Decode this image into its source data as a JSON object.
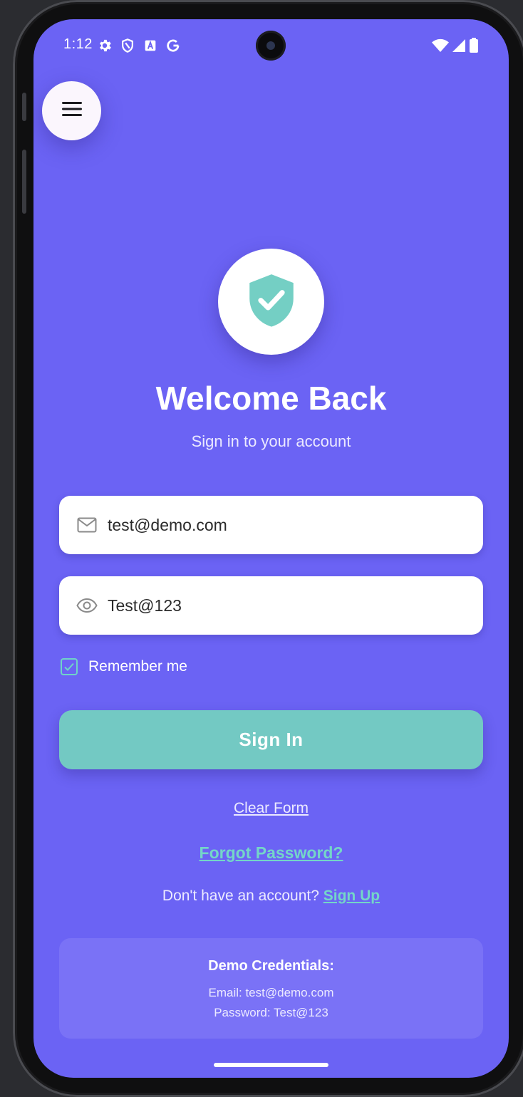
{
  "status_bar": {
    "time": "1:12",
    "left_icons": [
      "gear-icon",
      "shield-outline-icon",
      "a-square-icon",
      "google-g-icon"
    ],
    "right_icons": [
      "wifi-icon",
      "signal-icon",
      "battery-icon"
    ]
  },
  "menu": {
    "icon": "hamburger-menu-icon"
  },
  "logo": {
    "icon": "shield-check-icon",
    "color": "#74cfc4"
  },
  "header": {
    "title": "Welcome Back",
    "subtitle": "Sign in to your account"
  },
  "form": {
    "email": {
      "value": "test@demo.com",
      "icon": "mail-icon"
    },
    "password": {
      "value": "Test@123",
      "icon": "eye-icon"
    },
    "remember_label": "Remember me",
    "remember_checked": true,
    "submit_label": "Sign In"
  },
  "links": {
    "clear_form": "Clear Form",
    "forgot_password": "Forgot Password?",
    "signup_prompt": "Don't have an account?",
    "signup_link": "Sign Up"
  },
  "demo": {
    "title": "Demo Credentials:",
    "email_line": "Email: test@demo.com",
    "password_line": "Password: Test@123"
  },
  "colors": {
    "background": "#6b63f4",
    "accent": "#73c9c3",
    "link": "#74d6c8"
  }
}
